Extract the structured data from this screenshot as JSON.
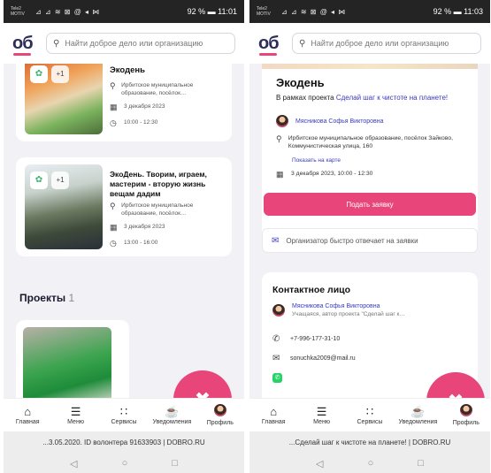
{
  "left": {
    "status": {
      "carrier": "Tele2 MOTIV",
      "signal": "⊿ ⊿ ≋ ⊠ @ ◂ ⋈",
      "battery": "92 % ▬ 11:01"
    },
    "logo": "об",
    "search": {
      "placeholder": "Найти доброе дело или организацию"
    },
    "events": [
      {
        "title": "Экодень",
        "plus": "+1",
        "place": "Ирбитское муниципальное образование, посёлок…",
        "date": "3 декабря 2023",
        "time": "10:00 - 12:30"
      },
      {
        "title": "ЭкоДень. Творим, играем, мастерим - вторую жизнь вещам дадим",
        "plus": "+1",
        "place": "Ирбитское муниципальное образование, посёлок…",
        "date": "3 декабря 2023",
        "time": "13:00 - 16:00"
      }
    ],
    "projects": {
      "label": "Проекты",
      "count": "1"
    },
    "url": "...3.05.2020. ID волонтера 91633903 | DOBRO.RU"
  },
  "right": {
    "status": {
      "carrier": "Tele2 MOTIV",
      "signal": "⊿ ⊿ ≋ ⊠ @ ◂ ⋈",
      "battery": "92 % ▬ 11:03"
    },
    "logo": "об",
    "search": {
      "placeholder": "Найти доброе дело или организацию"
    },
    "detail": {
      "title": "Экодень",
      "project_prefix": "В рамках проекта ",
      "project_link": "Сделай шаг к чистоте на планете!",
      "organizer": "Мясникова Софья Викторовна",
      "address": "Ирбитское муниципальное образование, посёлок Зайково, Коммунистическая улица, 160",
      "map_link": "Показать на карте",
      "datetime": "3 декабря 2023, 10:00 - 12:30"
    },
    "apply_label": "Подать заявку",
    "fast_reply": "Организатор быстро отвечает на заявки",
    "contact": {
      "title": "Контактное лицо",
      "name": "Мясникова Софья Викторовна",
      "role": "Учащаяся, автор проекта \"Сделай шаг к…",
      "phone": "+7-996-177-31-10",
      "email": "sonuchka2009@mail.ru"
    },
    "url": "...Сделай шаг к чистоте на планете! | DOBRO.RU"
  },
  "tabs": [
    {
      "icon": "home-icon",
      "label": "Главная"
    },
    {
      "icon": "menu-icon",
      "label": "Меню"
    },
    {
      "icon": "grid-icon",
      "label": "Сервисы"
    },
    {
      "icon": "bell-icon",
      "label": "Уведомления"
    },
    {
      "icon": "avatar",
      "label": "Профиль"
    }
  ],
  "colors": {
    "accent": "#e8457a",
    "link": "#3a3abf",
    "brand": "#2d2d5a"
  }
}
